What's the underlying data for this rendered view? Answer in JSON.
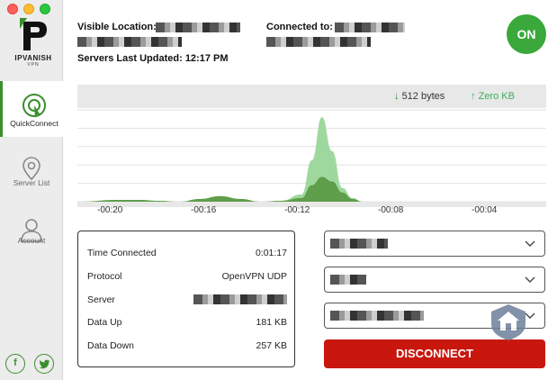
{
  "header": {
    "visible_location_label": "Visible Location:",
    "connected_to_label": "Connected to:",
    "servers_updated": "Servers Last Updated: 12:17 PM"
  },
  "status_button": {
    "label": "ON",
    "color": "#3aa83a"
  },
  "brand": {
    "name": "IPVANISH",
    "sub": "VPN"
  },
  "sidebar": {
    "items": [
      {
        "label": "QuickConnect",
        "icon": "quickconnect-icon",
        "active": true
      },
      {
        "label": "Server List",
        "icon": "location-pin-icon",
        "active": false
      },
      {
        "label": "Account",
        "icon": "user-icon",
        "active": false
      }
    ],
    "social": [
      {
        "label": "f",
        "icon": "facebook-icon"
      },
      {
        "label": "t",
        "icon": "twitter-icon"
      }
    ]
  },
  "traffic": {
    "download": "512 bytes",
    "upload": "Zero KB"
  },
  "chart_data": {
    "type": "area",
    "x_ticks": [
      "-00:20",
      "-00:16",
      "-00:12",
      "-00:08",
      "-00:04"
    ],
    "series": [
      {
        "color": "#9fd89f",
        "x": [
          -23,
          -21,
          -20,
          -19,
          -18,
          -17,
          -16,
          -15,
          -14,
          -13,
          -12,
          -11.5,
          -11,
          -10.5,
          -10,
          -9.5,
          -9,
          -8,
          -6,
          -2,
          0
        ],
        "values": [
          0,
          0,
          0.02,
          0.01,
          0,
          0.02,
          0.06,
          0.03,
          0,
          0.01,
          0.08,
          0.45,
          0.92,
          0.55,
          0.15,
          0.04,
          0,
          0,
          0,
          0,
          0
        ]
      },
      {
        "color": "#5f9e4a",
        "x": [
          -23,
          -21,
          -20,
          -19,
          -18,
          -17,
          -16,
          -15,
          -14,
          -13,
          -12,
          -11.5,
          -11,
          -10.5,
          -10,
          -9.5,
          -9,
          -8,
          -6,
          -2,
          0
        ],
        "values": [
          0,
          0.02,
          0.02,
          0.01,
          0,
          0.03,
          0.06,
          0.03,
          0,
          0.01,
          0.04,
          0.18,
          0.27,
          0.22,
          0.1,
          0.03,
          0,
          0,
          0,
          0,
          0
        ]
      }
    ],
    "xlim": [
      -23,
      0
    ],
    "ylim": [
      0,
      1
    ],
    "grid": true
  },
  "connection": {
    "rows": [
      {
        "key": "Time Connected",
        "value": "0:01:17",
        "name": "time-connected"
      },
      {
        "key": "Protocol",
        "value": "OpenVPN UDP",
        "name": "protocol"
      },
      {
        "key": "Server",
        "value": "",
        "name": "server"
      },
      {
        "key": "Data Up",
        "value": "181 KB",
        "name": "data-up"
      },
      {
        "key": "Data Down",
        "value": "257 KB",
        "name": "data-down"
      }
    ]
  },
  "disconnect": {
    "label": "DISCONNECT",
    "color": "#c9170e"
  }
}
